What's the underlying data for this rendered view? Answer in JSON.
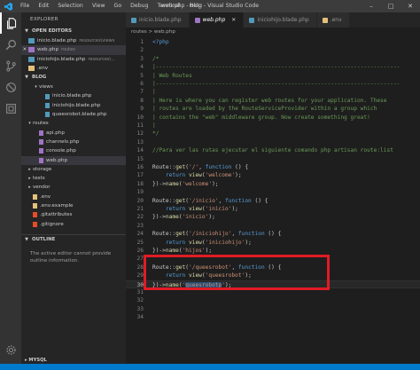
{
  "titlebar": {
    "menu": [
      "File",
      "Edit",
      "Selection",
      "View",
      "Go",
      "Debug",
      "Terminal",
      "Help"
    ],
    "title": "web.php - blog - Visual Studio Code"
  },
  "sidebar": {
    "title": "EXPLORER",
    "open_editors": {
      "header": "OPEN EDITORS",
      "items": [
        {
          "name": "inicio.blade.php",
          "hint": "resources\\views",
          "active": false,
          "color": "#519aba"
        },
        {
          "name": "web.php",
          "hint": "routes",
          "active": true,
          "color": "#a074c4"
        },
        {
          "name": "iniciohijo.blade.php",
          "hint": "resources\\...",
          "active": false,
          "color": "#519aba"
        },
        {
          "name": ".env",
          "hint": "",
          "active": false,
          "color": "#e5c07b"
        }
      ]
    },
    "project": {
      "header": "BLOG",
      "items": [
        {
          "name": "views",
          "indent": 1,
          "folder": true,
          "expanded": true
        },
        {
          "name": "inicio.blade.php",
          "indent": 2,
          "color": "#519aba"
        },
        {
          "name": "iniciohijo.blade.php",
          "indent": 2,
          "color": "#519aba"
        },
        {
          "name": "queesrobot.blade.php",
          "indent": 2,
          "color": "#519aba"
        },
        {
          "name": "routes",
          "indent": 0,
          "folder": true,
          "expanded": true
        },
        {
          "name": "api.php",
          "indent": 1,
          "color": "#a074c4"
        },
        {
          "name": "channels.php",
          "indent": 1,
          "color": "#a074c4"
        },
        {
          "name": "console.php",
          "indent": 1,
          "color": "#a074c4"
        },
        {
          "name": "web.php",
          "indent": 1,
          "color": "#a074c4",
          "active": true
        },
        {
          "name": "storage",
          "indent": 0,
          "folder": true,
          "expanded": false
        },
        {
          "name": "tests",
          "indent": 0,
          "folder": true,
          "expanded": false
        },
        {
          "name": "vendor",
          "indent": 0,
          "folder": true,
          "expanded": false
        },
        {
          "name": ".env",
          "indent": 0,
          "color": "#e5c07b"
        },
        {
          "name": ".env.example",
          "indent": 0,
          "color": "#e5c07b"
        },
        {
          "name": ".gitattributes",
          "indent": 0,
          "color": "#e44d26"
        },
        {
          "name": ".gitignore",
          "indent": 0,
          "color": "#e44d26"
        }
      ]
    },
    "outline": {
      "header": "OUTLINE",
      "message": "The active editor cannot provide outline information."
    },
    "mysql": "MYSQL"
  },
  "tabs": [
    {
      "label": "inicio.blade.php",
      "active": false,
      "color": "#519aba"
    },
    {
      "label": "web.php",
      "active": true,
      "color": "#a074c4"
    },
    {
      "label": "iniciohijo.blade.php",
      "active": false,
      "color": "#519aba"
    },
    {
      "label": ".env",
      "active": false,
      "color": "#e5c07b"
    }
  ],
  "breadcrumb": "routes > web.php",
  "editor": {
    "current_line": 30,
    "lines": [
      {
        "n": 1,
        "html": "<span class='t-tag'>&lt;?php</span>"
      },
      {
        "n": 2,
        "html": ""
      },
      {
        "n": 3,
        "html": "<span class='t-cm'>/*</span>"
      },
      {
        "n": 4,
        "html": "<span class='t-cm'>|--------------------------------------------------------------------------</span>"
      },
      {
        "n": 5,
        "html": "<span class='t-cm'>| Web Routes</span>"
      },
      {
        "n": 6,
        "html": "<span class='t-cm'>|--------------------------------------------------------------------------</span>"
      },
      {
        "n": 7,
        "html": "<span class='t-cm'>|</span>"
      },
      {
        "n": 8,
        "html": "<span class='t-cm'>| Here is where you can register web routes for your application. These</span>"
      },
      {
        "n": 9,
        "html": "<span class='t-cm'>| routes are loaded by the RouteServiceProvider within a group which</span>"
      },
      {
        "n": 10,
        "html": "<span class='t-cm'>| contains the \"web\" middleware group. Now create something great!</span>"
      },
      {
        "n": 11,
        "html": "<span class='t-cm'>|</span>"
      },
      {
        "n": 12,
        "html": "<span class='t-cm'>*/</span>"
      },
      {
        "n": 13,
        "html": ""
      },
      {
        "n": 14,
        "html": "<span class='t-cm'>//Para ver las rutas ejecutar el siguiente comando php artisan route:list</span>"
      },
      {
        "n": 15,
        "html": ""
      },
      {
        "n": 16,
        "html": "Route::<span class='t-fn'>get</span>(<span class='t-str'>'/'</span>, <span class='t-kw'>function</span> () {"
      },
      {
        "n": 17,
        "html": "    <span class='t-kw'>return</span> <span class='t-fn'>view</span>(<span class='t-str'>'welcome'</span>);"
      },
      {
        "n": 18,
        "html": "})-&gt;<span class='t-fn'>name</span>(<span class='t-str'>'welcome'</span>);"
      },
      {
        "n": 19,
        "html": ""
      },
      {
        "n": 20,
        "html": "Route::<span class='t-fn'>get</span>(<span class='t-str'>'/inicio'</span>, <span class='t-kw'>function</span> () {"
      },
      {
        "n": 21,
        "html": "    <span class='t-kw'>return</span> <span class='t-fn'>view</span>(<span class='t-str'>'inicio'</span>);"
      },
      {
        "n": 22,
        "html": "})-&gt;<span class='t-fn'>name</span>(<span class='t-str'>'inicio'</span>);"
      },
      {
        "n": 23,
        "html": ""
      },
      {
        "n": 24,
        "html": "Route::<span class='t-fn'>get</span>(<span class='t-str'>'/iniciohijo'</span>, <span class='t-kw'>function</span> () {"
      },
      {
        "n": 25,
        "html": "    <span class='t-kw'>return</span> <span class='t-fn'>view</span>(<span class='t-str'>'iniciohijo'</span>);"
      },
      {
        "n": 26,
        "html": "})-&gt;<span class='t-fn'>name</span>(<span class='t-str'>'hijos'</span>);"
      },
      {
        "n": 27,
        "html": ""
      },
      {
        "n": 28,
        "html": "Route::<span class='t-fn'>get</span>(<span class='t-str'>'/queesrobot'</span>, <span class='t-kw'>function</span> () {"
      },
      {
        "n": 29,
        "html": "    <span class='t-kw'>return</span> <span class='t-fn'>view</span>(<span class='t-str'>'queesrobot'</span>);"
      },
      {
        "n": 30,
        "html": "})-&gt;<span class='t-fn'>name</span>(<span class='t-str'>'<span class=\"sel-hl\">queesrobotp</span>'</span>);"
      },
      {
        "n": 31,
        "html": ""
      },
      {
        "n": 32,
        "html": ""
      },
      {
        "n": 33,
        "html": ""
      },
      {
        "n": 34,
        "html": ""
      }
    ]
  },
  "colors": {
    "highlight_box": "#e01b24",
    "statusbar": "#007acc"
  }
}
